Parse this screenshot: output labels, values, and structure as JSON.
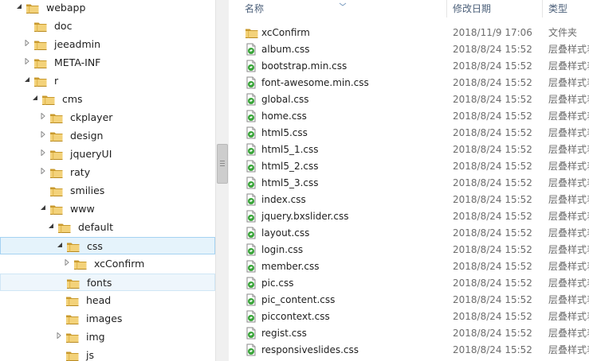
{
  "tree": {
    "items": [
      {
        "label": "webapp",
        "depth": 0,
        "arrow": "expanded",
        "state": ""
      },
      {
        "label": "doc",
        "depth": 1,
        "arrow": "none",
        "state": ""
      },
      {
        "label": "jeeadmin",
        "depth": 1,
        "arrow": "collapsed",
        "state": ""
      },
      {
        "label": "META-INF",
        "depth": 1,
        "arrow": "collapsed",
        "state": ""
      },
      {
        "label": "r",
        "depth": 1,
        "arrow": "expanded",
        "state": ""
      },
      {
        "label": "cms",
        "depth": 2,
        "arrow": "expanded",
        "state": ""
      },
      {
        "label": "ckplayer",
        "depth": 3,
        "arrow": "collapsed",
        "state": ""
      },
      {
        "label": "design",
        "depth": 3,
        "arrow": "collapsed",
        "state": ""
      },
      {
        "label": "jqueryUI",
        "depth": 3,
        "arrow": "collapsed",
        "state": ""
      },
      {
        "label": "raty",
        "depth": 3,
        "arrow": "collapsed",
        "state": ""
      },
      {
        "label": "smilies",
        "depth": 3,
        "arrow": "none",
        "state": ""
      },
      {
        "label": "www",
        "depth": 3,
        "arrow": "expanded",
        "state": ""
      },
      {
        "label": "default",
        "depth": 4,
        "arrow": "expanded",
        "state": ""
      },
      {
        "label": "css",
        "depth": 5,
        "arrow": "expanded",
        "state": "selected"
      },
      {
        "label": "xcConfirm",
        "depth": 6,
        "arrow": "collapsed",
        "state": ""
      },
      {
        "label": "fonts",
        "depth": 5,
        "arrow": "none",
        "state": "hover"
      },
      {
        "label": "head",
        "depth": 5,
        "arrow": "none",
        "state": ""
      },
      {
        "label": "images",
        "depth": 5,
        "arrow": "none",
        "state": ""
      },
      {
        "label": "img",
        "depth": 5,
        "arrow": "collapsed",
        "state": ""
      },
      {
        "label": "js",
        "depth": 5,
        "arrow": "none",
        "state": ""
      }
    ]
  },
  "list": {
    "headers": {
      "name": "名称",
      "date": "修改日期",
      "type": "类型"
    },
    "rows": [
      {
        "name": "xcConfirm",
        "date": "2018/11/9 17:06",
        "type": "文件夹",
        "icon": "folder-icon"
      },
      {
        "name": "album.css",
        "date": "2018/8/24 15:52",
        "type": "层叠样式表文档",
        "icon": "css-file-icon"
      },
      {
        "name": "bootstrap.min.css",
        "date": "2018/8/24 15:52",
        "type": "层叠样式表文档",
        "icon": "css-file-icon"
      },
      {
        "name": "font-awesome.min.css",
        "date": "2018/8/24 15:52",
        "type": "层叠样式表文档",
        "icon": "css-file-icon"
      },
      {
        "name": "global.css",
        "date": "2018/8/24 15:52",
        "type": "层叠样式表文档",
        "icon": "css-file-icon"
      },
      {
        "name": "home.css",
        "date": "2018/8/24 15:52",
        "type": "层叠样式表文档",
        "icon": "css-file-icon"
      },
      {
        "name": "html5.css",
        "date": "2018/8/24 15:52",
        "type": "层叠样式表文档",
        "icon": "css-file-icon"
      },
      {
        "name": "html5_1.css",
        "date": "2018/8/24 15:52",
        "type": "层叠样式表文档",
        "icon": "css-file-icon"
      },
      {
        "name": "html5_2.css",
        "date": "2018/8/24 15:52",
        "type": "层叠样式表文档",
        "icon": "css-file-icon"
      },
      {
        "name": "html5_3.css",
        "date": "2018/8/24 15:52",
        "type": "层叠样式表文档",
        "icon": "css-file-icon"
      },
      {
        "name": "index.css",
        "date": "2018/8/24 15:52",
        "type": "层叠样式表文档",
        "icon": "css-file-icon"
      },
      {
        "name": "jquery.bxslider.css",
        "date": "2018/8/24 15:52",
        "type": "层叠样式表文档",
        "icon": "css-file-icon"
      },
      {
        "name": "layout.css",
        "date": "2018/8/24 15:52",
        "type": "层叠样式表文档",
        "icon": "css-file-icon"
      },
      {
        "name": "login.css",
        "date": "2018/8/24 15:52",
        "type": "层叠样式表文档",
        "icon": "css-file-icon"
      },
      {
        "name": "member.css",
        "date": "2018/8/24 15:52",
        "type": "层叠样式表文档",
        "icon": "css-file-icon"
      },
      {
        "name": "pic.css",
        "date": "2018/8/24 15:52",
        "type": "层叠样式表文档",
        "icon": "css-file-icon"
      },
      {
        "name": "pic_content.css",
        "date": "2018/8/24 15:52",
        "type": "层叠样式表文档",
        "icon": "css-file-icon"
      },
      {
        "name": "piccontext.css",
        "date": "2018/8/24 15:52",
        "type": "层叠样式表文档",
        "icon": "css-file-icon"
      },
      {
        "name": "regist.css",
        "date": "2018/8/24 15:52",
        "type": "层叠样式表文档",
        "icon": "css-file-icon"
      },
      {
        "name": "responsiveslides.css",
        "date": "2018/8/24 15:52",
        "type": "层叠样式表文档",
        "icon": "css-file-icon"
      }
    ]
  },
  "colors": {
    "folder": "#e8c35a",
    "folder_dark": "#c99a2e",
    "selected": "#e5f3fb",
    "css_badge": "#3aa53a",
    "header_text": "#4c607a"
  }
}
